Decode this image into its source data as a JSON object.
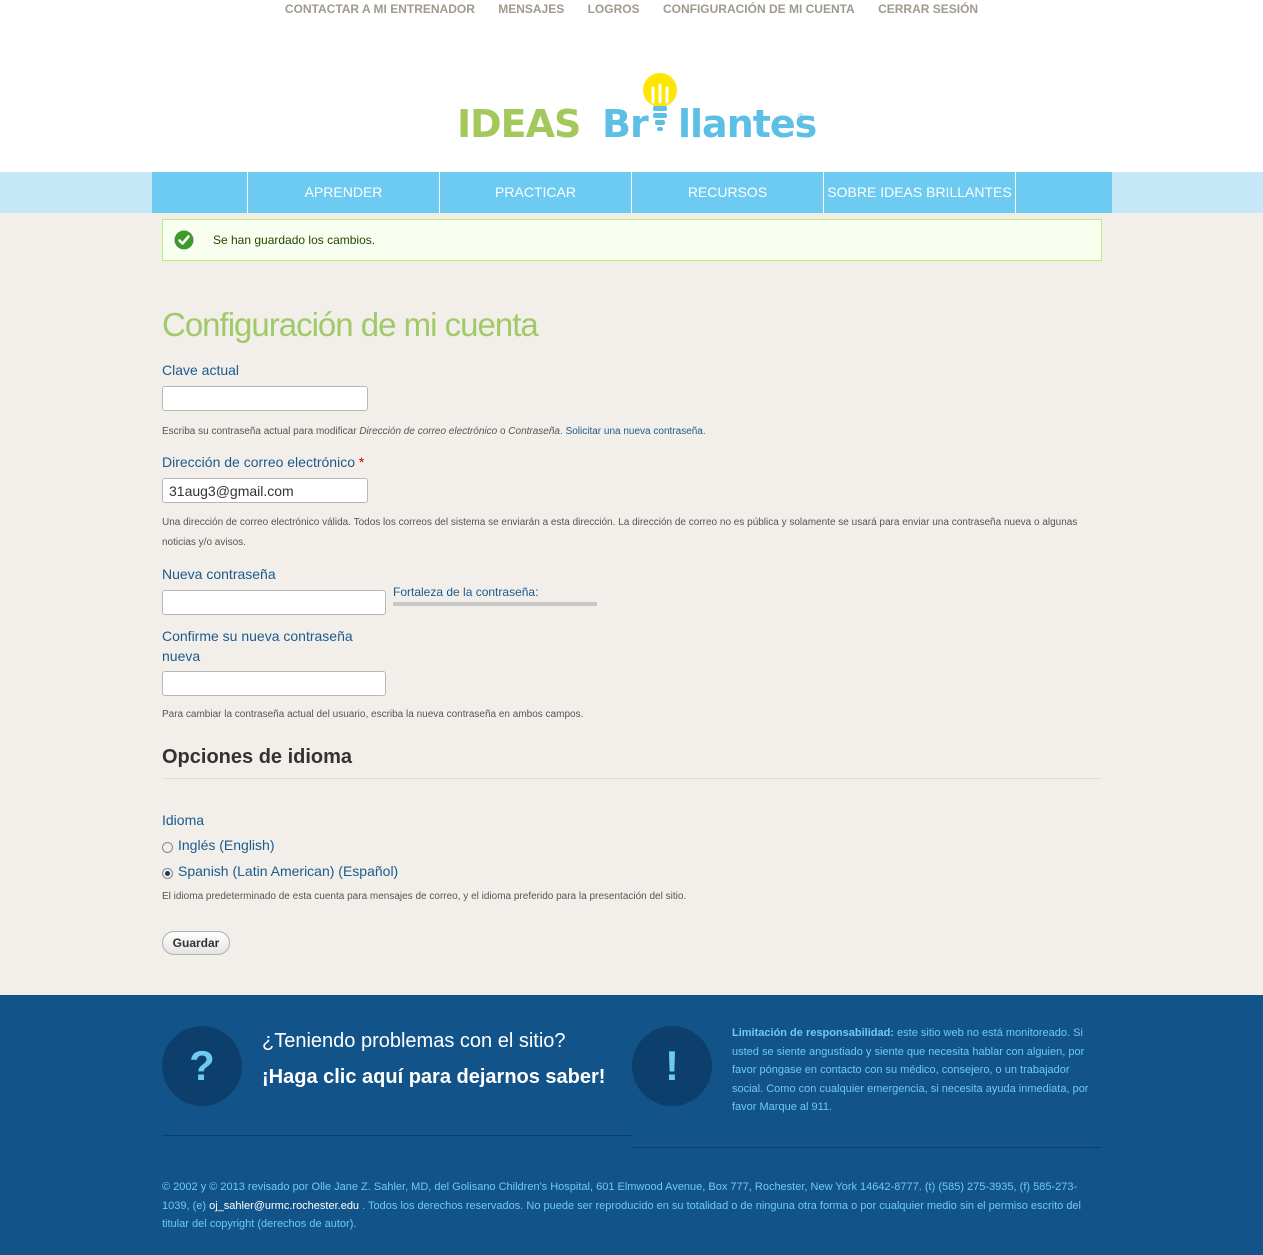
{
  "top_links": [
    "CONTACTAR A MI ENTRENADOR",
    "MENSAJES",
    "LOGROS",
    "CONFIGURACIÓN DE MI CUENTA",
    "CERRAR SESIÓN"
  ],
  "logo": {
    "part1": "IDEAS",
    "part2": "Br",
    "part3": "llantes",
    "reg": "®"
  },
  "nav": [
    "APRENDER",
    "PRACTICAR",
    "RECURSOS",
    "SOBRE IDEAS BRILLANTES"
  ],
  "status_message": "Se han guardado los cambios.",
  "page_title": "Configuración de mi cuenta",
  "form": {
    "current_pass": {
      "label": "Clave actual",
      "help_pre": "Escriba su contraseña actual para modificar ",
      "help_em1": "Dirección de correo electrónico",
      "help_mid": " o ",
      "help_em2": "Contraseña",
      "help_post": ". ",
      "help_link": "Solicitar una nueva contraseña",
      "help_end": "."
    },
    "email": {
      "label": "Dirección de correo electrónico",
      "required": "*",
      "value": "31aug3@gmail.com",
      "help": "Una dirección de correo electrónico válida. Todos los correos del sistema se enviarán a esta dirección. La dirección de correo no es pública y solamente se usará para enviar una contraseña nueva o algunas noticias y/o avisos."
    },
    "new_pass": {
      "label": "Nueva contraseña",
      "strength_label": "Fortaleza de la contraseña:",
      "strength": 0
    },
    "confirm_pass": {
      "label": "Confirme su nueva contraseña nueva",
      "help": "Para cambiar la contraseña actual del usuario, escriba la nueva contraseña en ambos campos."
    }
  },
  "language": {
    "section_title": "Opciones de idioma",
    "label": "Idioma",
    "options": [
      "Inglés (English)",
      "Spanish (Latin American) (Español)"
    ],
    "selected": "Spanish (Latin American) (Español)",
    "help": "El idioma predeterminado de esta cuenta para mensajes de correo, y el idioma preferido para la presentación del sitio."
  },
  "save_label": "Guardar",
  "footer": {
    "q_icon": "?",
    "q_text": "¿Teniendo problemas con el sitio?",
    "q_link": "¡Haga clic aquí para dejarnos saber!",
    "alert_icon": "!",
    "disclaimer_title": "Limitación de responsabilidad:",
    "disclaimer_body": " este sitio web no está monitoreado. Si usted se siente angustiado y siente que necesita hablar con alguien, por favor póngase en contacto con su médico, consejero, o un trabajador social. Como con cualquier emergencia, si necesita ayuda inmediata, por favor Marque al 911.",
    "copyright_pre": "© 2002 y © 2013 revisado por Olle Jane Z. Sahler, MD, del Golisano Children's Hospital, 601 Elmwood Avenue, Box 777, Rochester, New York 14642-8777. (t) (585) 275-3935, (f) 585-273-1039, (e) ",
    "copyright_email": "oj_sahler@urmc.rochester.edu",
    "copyright_post": " . Todos los derechos reservados. No puede ser reproducido en su totalidad o de ninguna otra forma o por cualquier medio sin el permiso escrito del titular del copyright (derechos de autor)."
  },
  "colors": {
    "green": "#a0c967",
    "blue_nav": "#6dcaf1",
    "footer_bg": "#12548a",
    "link": "#1c5a8e"
  }
}
